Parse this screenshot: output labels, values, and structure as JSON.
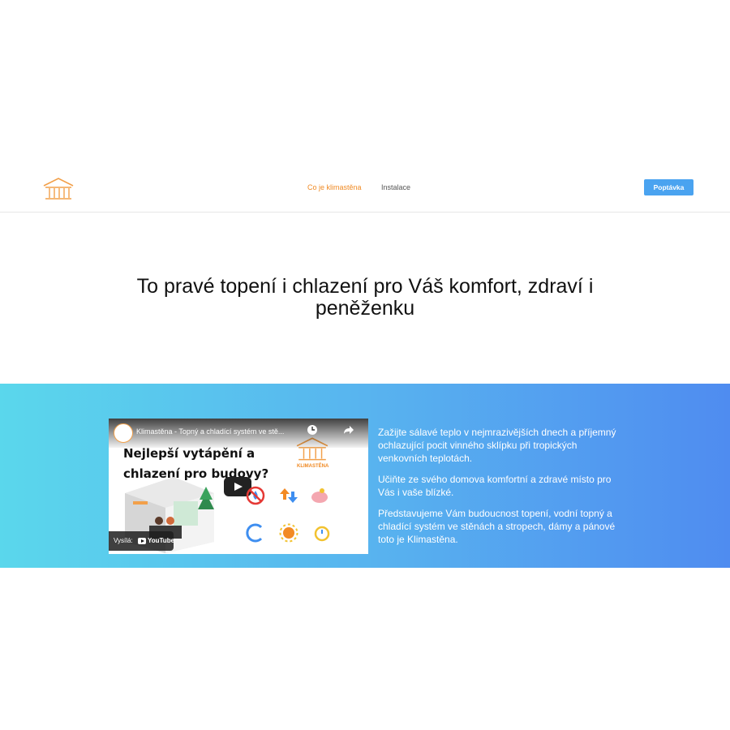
{
  "nav": {
    "items": [
      {
        "label": "Co je klimastěna",
        "active": true
      },
      {
        "label": "Instalace",
        "active": false
      }
    ],
    "cta_label": "Poptávka"
  },
  "hero": {
    "title": "To pravé topení i chlazení pro Váš komfort, zdraví i peněženku"
  },
  "video": {
    "title": "Klimastěna - Topný a chladící systém ve stě...",
    "thumb_line1": "Nejlepší vytápění a",
    "thumb_line2": "chlazení pro budovy?",
    "thumb_brand": "KLIMASTĚNA",
    "sent_by_label": "Vysílá:",
    "youtube_label": "YouTube",
    "play_icon": "play-icon"
  },
  "intro": {
    "paragraphs": [
      "Zažijte sálavé teplo v nejmrazivějších dnech a příjemný ochlazující pocit vinného sklípku při tropických venkovních teplotách.",
      "Učiňte ze svého domova komfortní a zdravé místo pro Vás i vaše blízké.",
      "Představujeme Vám budoucnost topení, vodní topný a chladící systém ve stěnách a stropech, dámy a pánové toto je Klimastěna."
    ]
  },
  "colors": {
    "accent": "#f08a24",
    "cta": "#4aa3f0",
    "band_start": "#5ad7ec",
    "band_end": "#4f8cf0"
  }
}
